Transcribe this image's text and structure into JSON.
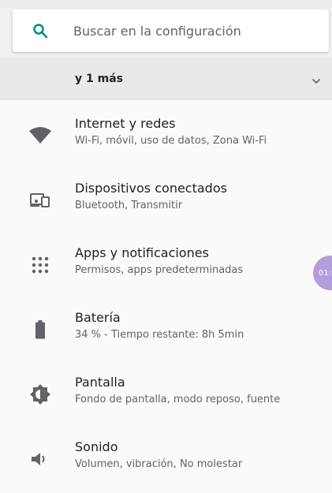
{
  "search": {
    "placeholder": "Buscar en la configuración",
    "icon": "search-icon",
    "icon_color": "#00897b"
  },
  "suggestions": {
    "label": "y 1 más",
    "expand_icon": "chevron-down-icon"
  },
  "settings": [
    {
      "title": "Internet y redes",
      "subtitle": "Wi-Fi, móvil, uso de datos, Zona Wi-Fi",
      "icon": "wifi-icon"
    },
    {
      "title": "Dispositivos conectados",
      "subtitle": "Bluetooth, Transmitir",
      "icon": "connected-devices-icon"
    },
    {
      "title": "Apps y notificaciones",
      "subtitle": "Permisos, apps predeterminadas",
      "icon": "apps-grid-icon"
    },
    {
      "title": "Batería",
      "subtitle": "34 % - Tiempo restante: 8h 5min",
      "icon": "battery-icon"
    },
    {
      "title": "Pantalla",
      "subtitle": "Fondo de pantalla, modo reposo, fuente",
      "icon": "display-brightness-icon"
    },
    {
      "title": "Sonido",
      "subtitle": "Volumen, vibración, No molestar",
      "icon": "volume-icon"
    }
  ],
  "floating_bubble": {
    "text": "01:",
    "color": "#b39ddb"
  },
  "colors": {
    "icon": "#5f6368",
    "accent": "#00897b"
  }
}
